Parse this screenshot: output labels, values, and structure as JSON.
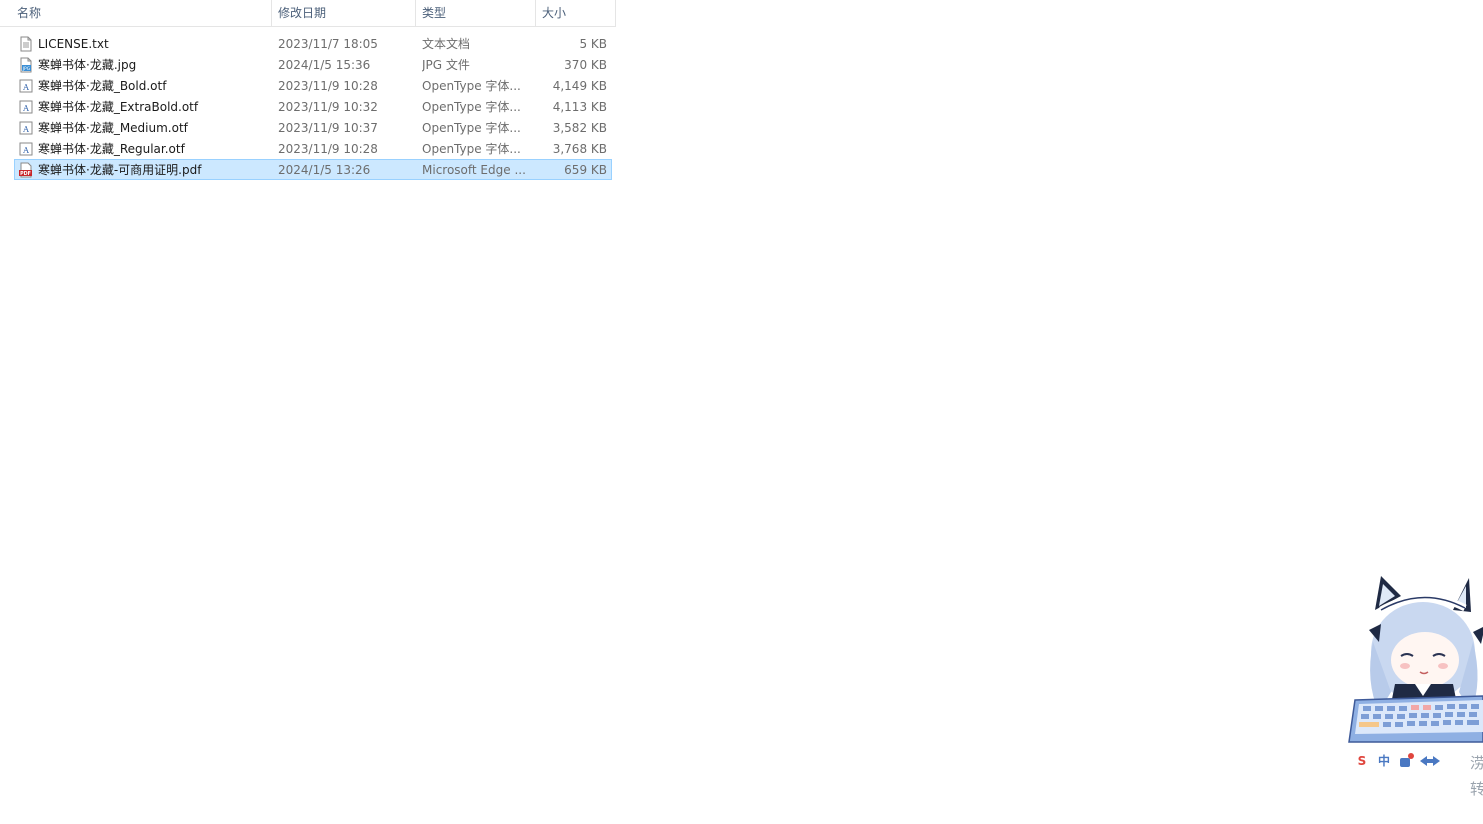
{
  "columns": {
    "name": "名称",
    "date": "修改日期",
    "type": "类型",
    "size": "大小"
  },
  "files": [
    {
      "name": "LICENSE.txt",
      "date": "2023/11/7 18:05",
      "type": "文本文档",
      "size": "5 KB",
      "icon": "text-file-icon"
    },
    {
      "name": "寒蝉书体·龙藏.jpg",
      "date": "2024/1/5 15:36",
      "type": "JPG 文件",
      "size": "370 KB",
      "icon": "jpg-file-icon"
    },
    {
      "name": "寒蝉书体·龙藏_Bold.otf",
      "date": "2023/11/9 10:28",
      "type": "OpenType 字体...",
      "size": "4,149 KB",
      "icon": "font-file-icon"
    },
    {
      "name": "寒蝉书体·龙藏_ExtraBold.otf",
      "date": "2023/11/9 10:32",
      "type": "OpenType 字体...",
      "size": "4,113 KB",
      "icon": "font-file-icon"
    },
    {
      "name": "寒蝉书体·龙藏_Medium.otf",
      "date": "2023/11/9 10:37",
      "type": "OpenType 字体...",
      "size": "3,582 KB",
      "icon": "font-file-icon"
    },
    {
      "name": "寒蝉书体·龙藏_Regular.otf",
      "date": "2023/11/9 10:28",
      "type": "OpenType 字体...",
      "size": "3,768 KB",
      "icon": "font-file-icon"
    },
    {
      "name": "寒蝉书体·龙藏-可商用证明.pdf",
      "date": "2024/1/5 13:26",
      "type": "Microsoft Edge ...",
      "size": "659 KB",
      "icon": "pdf-file-icon",
      "selected": true
    }
  ],
  "ime": {
    "sogou": "S",
    "chinese": "中",
    "edge_1": "涝",
    "edge_2": "转"
  },
  "colors": {
    "selection_bg": "#cce8ff",
    "selection_border": "#99d1ff",
    "header_text": "#4c607a",
    "pdf_red": "#c8262b",
    "ime_red": "#e0463e",
    "ime_blue": "#4a78c2"
  }
}
